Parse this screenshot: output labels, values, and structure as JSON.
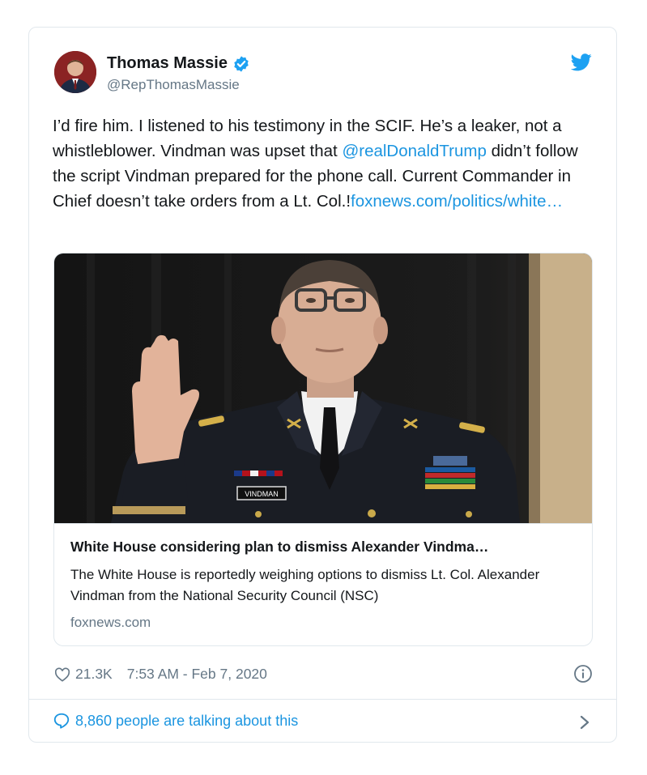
{
  "tweet": {
    "author_name": "Thomas Massie",
    "author_handle": "@RepThomasMassie",
    "text_part1": "I’d fire him. I listened to his testimony in the SCIF. He’s a leaker, not a whistleblower. Vindman was upset that ",
    "mention": "@realDonaldTrump",
    "text_part2": " didn’t follow the script Vindman prepared for the phone call. Current Commander in Chief doesn’t take orders from a Lt. Col.!",
    "link_text": "foxnews.com/politics/white…",
    "likes": "21.3K",
    "timestamp": "7:53 AM - Feb 7, 2020",
    "talking": "8,860 people are talking about this"
  },
  "link_card": {
    "title": "White House considering plan to dismiss Alexander Vindma…",
    "description": "The White House is reportedly weighing options to dismiss Lt. Col. Alexander Vindman from the National Security Council (NSC)",
    "domain": "foxnews.com",
    "nameplate": "VINDMAN"
  },
  "icons": {
    "verified": "verified-badge-icon",
    "brand": "twitter-bird-icon",
    "like": "heart-icon",
    "info": "info-icon",
    "reply": "speech-bubble-icon",
    "chevron": "chevron-right-icon"
  },
  "colors": {
    "link": "#1b95e0",
    "secondary_text": "#657786",
    "border": "#e1e8ed"
  }
}
